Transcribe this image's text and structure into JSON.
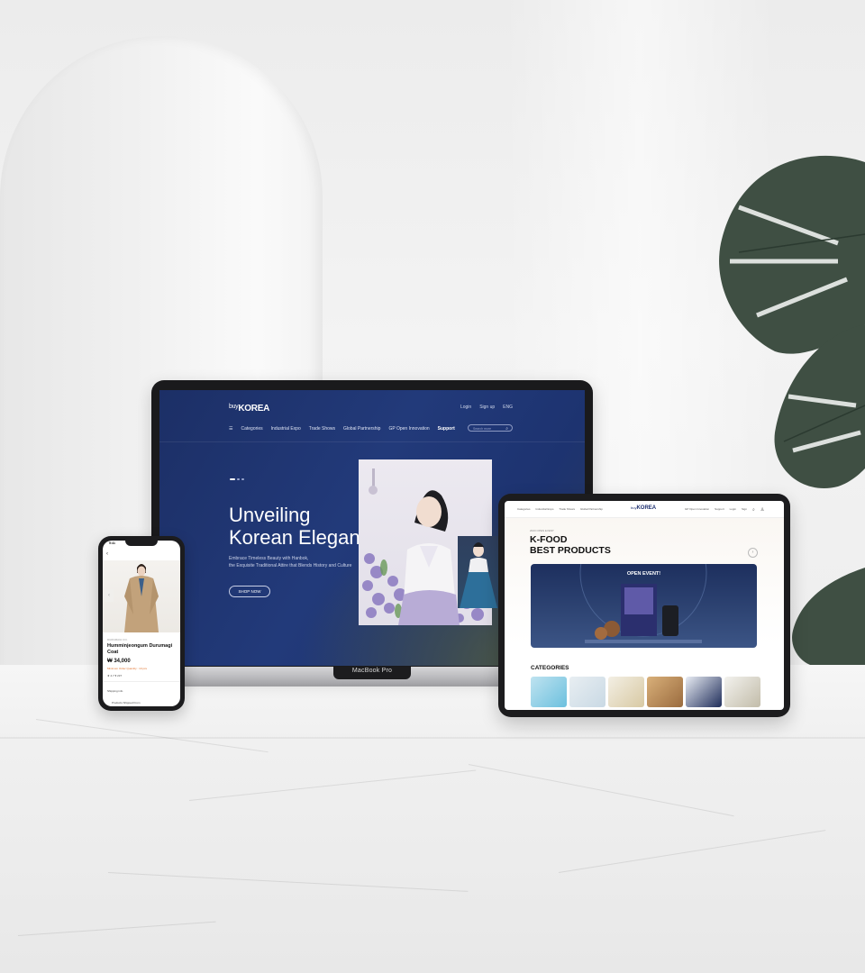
{
  "laptop": {
    "device_label": "MacBook Pro",
    "nav": {
      "logo_small": "buy",
      "logo_main": "KOREA",
      "top_links": [
        "Login",
        "Sign up",
        "ENG"
      ],
      "menu": [
        "Categories",
        "Industrial Expo",
        "Trade Shows",
        "Global Partnership",
        "GP Open Innovation",
        "Support"
      ],
      "search_placeholder": "Search more"
    },
    "hero": {
      "title_line1": "Unveiling",
      "title_line2": "Korean Elegance",
      "subtitle_line1": "Embrace Timeless Beauty with Hanbok,",
      "subtitle_line2": "the Exquisite Traditional Attire that Blends History and Culture",
      "cta": "SHOP NOW"
    }
  },
  "tablet": {
    "nav": {
      "menu": [
        "Categories",
        "Industrial Expo",
        "Trade Shows",
        "Global Partnership"
      ],
      "logo_small": "buy",
      "logo_main": "KOREA",
      "right": [
        "GP Open Innovation",
        "Support",
        "Login",
        "Sign"
      ]
    },
    "event_label": "2023 OPEN EVENT",
    "title_line1": "K-FOOD",
    "title_line2": "BEST PRODUCTS",
    "banner_text": "OPEN EVENT!",
    "categories_title": "CATEGORIES"
  },
  "phone": {
    "time": "9:41",
    "brand": "DURUMAGI CO.",
    "product_name": "Humminjeongum Durumagi Coat",
    "price": "₩ 34,000",
    "sub_note": "Minimum Order Quantity : 10 pcs",
    "rating": "★ 4.7   ♥ 237",
    "shipping": "Shipping info",
    "shipped_from": "Products Shipped From"
  },
  "colors": {
    "navy": "#1e3370",
    "white": "#ffffff",
    "accent_orange": "#e0702a"
  }
}
